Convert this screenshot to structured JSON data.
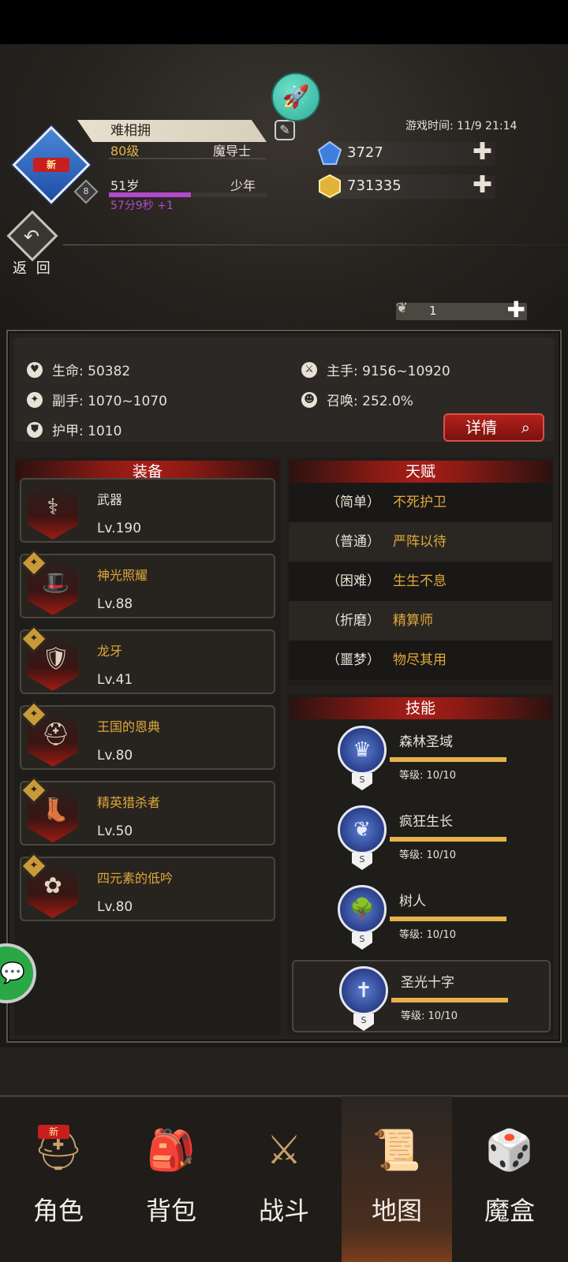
{
  "header": {
    "player_name": "难相拥",
    "level": "80级",
    "class": "魔导士",
    "age": "51岁",
    "life_stage": "少年",
    "age_timer": "57分9秒 +1",
    "avatar_badge": "新",
    "avatar_level": "8",
    "game_time": "游戏时间: 11/9 21:14",
    "gems": "3727",
    "gold": "731335",
    "return_label": "返 回",
    "item_count": "1"
  },
  "stats": {
    "hp": "生命: 50382",
    "main_hand": "主手: 9156~10920",
    "off_hand": "副手: 1070~1070",
    "summon": "召唤: 252.0%",
    "armor": "护甲: 1010",
    "detail_button": "详情"
  },
  "equipment": {
    "title": "装备",
    "items": [
      {
        "name": "武器",
        "level": "Lv.190",
        "color": "#e8e2d6"
      },
      {
        "name": "神光照耀",
        "level": "Lv.88",
        "color": "#e0a83a"
      },
      {
        "name": "龙牙",
        "level": "Lv.41",
        "color": "#e0a83a"
      },
      {
        "name": "王国的恩典",
        "level": "Lv.80",
        "color": "#e0a83a"
      },
      {
        "name": "精英猎杀者",
        "level": "Lv.50",
        "color": "#e0a83a"
      },
      {
        "name": "四元素的低吟",
        "level": "Lv.80",
        "color": "#e0a83a"
      }
    ]
  },
  "talents": {
    "title": "天赋",
    "items": [
      {
        "difficulty": "（简单）",
        "name": "不死护卫"
      },
      {
        "difficulty": "（普通）",
        "name": "严阵以待"
      },
      {
        "difficulty": "（困难）",
        "name": "生生不息"
      },
      {
        "difficulty": "（折磨）",
        "name": "精算师"
      },
      {
        "difficulty": "（噩梦）",
        "name": "物尽其用"
      }
    ]
  },
  "skills": {
    "title": "技能",
    "items": [
      {
        "name": "森林圣域",
        "level": "等级: 10/10",
        "grade": "S",
        "progress": 1.0
      },
      {
        "name": "疯狂生长",
        "level": "等级: 10/10",
        "grade": "S",
        "progress": 1.0
      },
      {
        "name": "树人",
        "level": "等级: 10/10",
        "grade": "S",
        "progress": 1.0
      },
      {
        "name": "圣光十字",
        "level": "等级: 10/10",
        "grade": "S",
        "progress": 1.0
      }
    ]
  },
  "nav": {
    "items": [
      {
        "label": "角色",
        "new_badge": "新"
      },
      {
        "label": "背包"
      },
      {
        "label": "战斗"
      },
      {
        "label": "地图"
      },
      {
        "label": "魔盒"
      }
    ],
    "active": "地图"
  },
  "colors": {
    "accent_red": "#a61e18",
    "gold_text": "#e0a83a",
    "level_text": "#e3b54a",
    "age_purple": "#b24acb",
    "bar_gold": "#e6b04a"
  }
}
